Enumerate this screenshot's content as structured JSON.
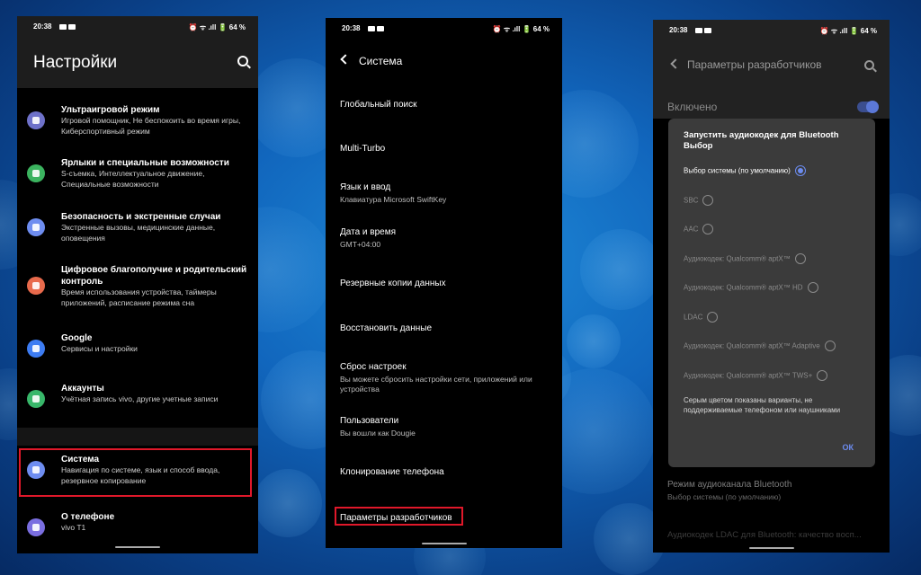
{
  "colors": {
    "highlight": "#e0182a",
    "accent": "#6c8cf0",
    "phone_bg": "#000000"
  },
  "status_bar": {
    "time": "20:38",
    "indicators": "⏰ ᯤ .ıll 🔋 64 %"
  },
  "phone1": {
    "title": "Настройки",
    "items": [
      {
        "title": "Ультраигровой режим",
        "subtitle": "Игровой помощник, Не беспокоить во время игры, Киберспортивный режим",
        "icon": "gamepad-icon",
        "color": "#6e71c9"
      },
      {
        "title": "Ярлыки и специальные возможности",
        "subtitle": "S-съемка, Интеллектуальное движение, Специальные возможности",
        "icon": "accessibility-icon",
        "color": "#3bb35f"
      },
      {
        "title": "Безопасность и экстренные случаи",
        "subtitle": "Экстренные вызовы, медицинские данные, оповещения",
        "icon": "emergency-icon",
        "color": "#6e8df0"
      },
      {
        "title": "Цифровое благополучие и родительский контроль",
        "subtitle": "Время использования устройства, таймеры приложений, расписание режима сна",
        "icon": "wellbeing-icon",
        "color": "#e86a4c"
      },
      {
        "title": "Google",
        "subtitle": "Сервисы и настройки",
        "icon": "google-icon",
        "color": "#3d7cf2"
      },
      {
        "title": "Аккаунты",
        "subtitle": "Учётная запись vivo, другие учетные записи",
        "icon": "account-key-icon",
        "color": "#38b76a"
      },
      {
        "title": "Система",
        "subtitle": "Навигация по системе, язык и способ ввода, резервное копирование",
        "icon": "system-icon",
        "color": "#6e8df0"
      },
      {
        "title": "О телефоне",
        "subtitle": "vivo T1",
        "icon": "phone-info-icon",
        "color": "#7a6ee0"
      }
    ]
  },
  "phone2": {
    "title": "Система",
    "items": [
      {
        "title": "Глобальный поиск",
        "subtitle": ""
      },
      {
        "title": "Multi-Turbo",
        "subtitle": ""
      },
      {
        "title": "Язык и ввод",
        "subtitle": "Клавиатура Microsoft SwiftKey"
      },
      {
        "title": "Дата и время",
        "subtitle": "GMT+04:00"
      },
      {
        "title": "Резервные копии данных",
        "subtitle": ""
      },
      {
        "title": "Восстановить данные",
        "subtitle": ""
      },
      {
        "title": "Сброс настроек",
        "subtitle": "Вы можете сбросить настройки сети, приложений или устройства"
      },
      {
        "title": "Пользователи",
        "subtitle": "Вы вошли как Dougie"
      },
      {
        "title": "Клонирование телефона",
        "subtitle": ""
      },
      {
        "title": "Параметры разработчиков",
        "subtitle": ""
      }
    ]
  },
  "phone3": {
    "title": "Параметры разработчиков",
    "enabled_label": "Включено",
    "dialog": {
      "title": "Запустить аудиокодек для Bluetooth Выбор",
      "options": [
        {
          "label": "Выбор системы (по умолчанию)",
          "selected": true
        },
        {
          "label": "SBC",
          "selected": false
        },
        {
          "label": "AAC",
          "selected": false
        },
        {
          "label": "Аудиокодек: Qualcomm® aptX™",
          "selected": false
        },
        {
          "label": "Аудиокодек: Qualcomm® aptX™ HD",
          "selected": false
        },
        {
          "label": "LDAC",
          "selected": false
        },
        {
          "label": "Аудиокодек: Qualcomm® aptX™ Adaptive",
          "selected": false
        },
        {
          "label": "Аудиокодек: Qualcomm® aptX™ TWS+",
          "selected": false
        }
      ],
      "note": "Серым цветом показаны варианты, не поддерживаемые телефоном или наушниками",
      "ok": "ОК"
    },
    "below_title": "Режим аудиоканала Bluetooth",
    "below_subtitle": "Выбор системы (по умолчанию)",
    "below_cut": "Аудиокодек LDAC для Bluetooth: качество восп..."
  }
}
